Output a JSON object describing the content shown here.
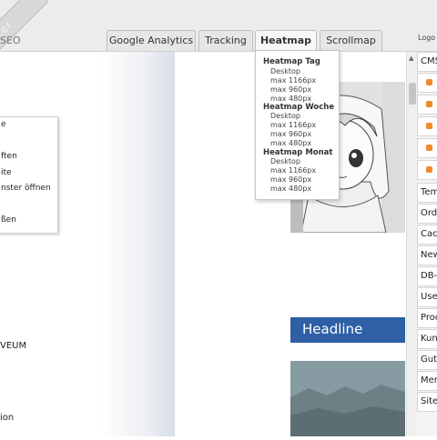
{
  "header": {
    "corner_text": "ter",
    "seo_label": "SEO",
    "tabs": [
      {
        "label": "Google Analytics",
        "active": false
      },
      {
        "label": "Tracking",
        "active": false
      },
      {
        "label": "Heatmap",
        "active": true
      },
      {
        "label": "Scrollmap",
        "active": false
      }
    ],
    "logout_label": "Logo"
  },
  "left_context_menu": {
    "items": [
      "e",
      "",
      "ften",
      "ite",
      "nster öffnen",
      "",
      "ßen"
    ]
  },
  "left_text": [
    "VEUM",
    "ion"
  ],
  "heatmap_dropdown": {
    "groups": [
      {
        "title": "Heatmap Tag",
        "items": [
          "Desktop",
          "max 1166px",
          "max 960px",
          "max 480px"
        ]
      },
      {
        "title": "Heatmap Woche",
        "items": [
          "Desktop",
          "max 1166px",
          "max 960px",
          "max 480px"
        ]
      },
      {
        "title": "Heatmap Monat",
        "items": [
          "Desktop",
          "max 1166px",
          "max 960px",
          "max 480px"
        ]
      }
    ]
  },
  "content": {
    "headline": "Headline"
  },
  "right_panel": {
    "top_label": "CMS",
    "icon_count": 5,
    "items": [
      "Tem",
      "Ord",
      "Cac",
      "New",
      "DB-",
      "Use",
      "Proc",
      "Kun",
      "Gut",
      "Mer",
      "Site"
    ]
  },
  "colors": {
    "headline_bg": "#2f5fa5",
    "icon_orange": "#f0892a"
  }
}
